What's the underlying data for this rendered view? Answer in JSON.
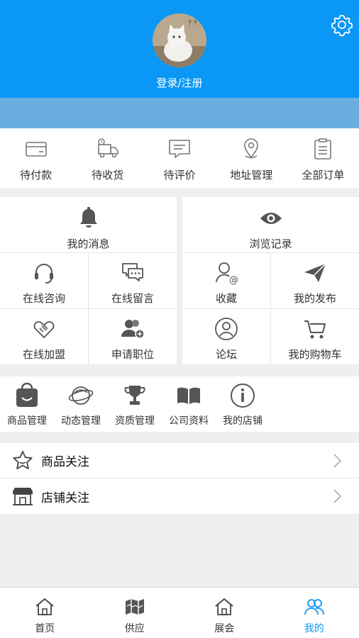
{
  "header": {
    "login_label": "登录/注册",
    "accent": "#0a97f5"
  },
  "orders": [
    {
      "icon": "card-icon",
      "label": "待付款"
    },
    {
      "icon": "truck-icon",
      "label": "待收货"
    },
    {
      "icon": "comment-icon",
      "label": "待评价"
    },
    {
      "icon": "location-pin-icon",
      "label": "地址管理"
    },
    {
      "icon": "clipboard-icon",
      "label": "全部订单"
    }
  ],
  "left_grid": {
    "top": {
      "icon": "bell-icon",
      "label": "我的消息"
    },
    "cells": [
      {
        "icon": "headset-icon",
        "label": "在线咨询"
      },
      {
        "icon": "chat-bubbles-icon",
        "label": "在线留言"
      },
      {
        "icon": "handshake-icon",
        "label": "在线加盟"
      },
      {
        "icon": "add-user-icon",
        "label": "申请职位"
      }
    ]
  },
  "right_grid": {
    "top": {
      "icon": "eye-icon",
      "label": "浏览记录"
    },
    "cells": [
      {
        "icon": "user-at-icon",
        "label": "收藏"
      },
      {
        "icon": "paper-plane-icon",
        "label": "我的发布"
      },
      {
        "icon": "user-circle-icon",
        "label": "论坛"
      },
      {
        "icon": "shopping-cart-icon",
        "label": "我的购物车"
      }
    ]
  },
  "tools": [
    {
      "icon": "shopping-bag-icon",
      "label": "商品管理"
    },
    {
      "icon": "planet-icon",
      "label": "动态管理"
    },
    {
      "icon": "trophy-icon",
      "label": "资质管理"
    },
    {
      "icon": "book-icon",
      "label": "公司资料"
    },
    {
      "icon": "info-circle-icon",
      "label": "我的店铺"
    }
  ],
  "follow_list": [
    {
      "icon": "star-icon",
      "label": "商品关注"
    },
    {
      "icon": "store-icon",
      "label": "店铺关注"
    }
  ],
  "tabbar": {
    "active": "我的",
    "tabs": [
      {
        "icon": "home-icon",
        "label": "首页"
      },
      {
        "icon": "map-icon",
        "label": "供应"
      },
      {
        "icon": "home-icon",
        "label": "展会"
      },
      {
        "icon": "users-icon",
        "label": "我的"
      }
    ]
  }
}
